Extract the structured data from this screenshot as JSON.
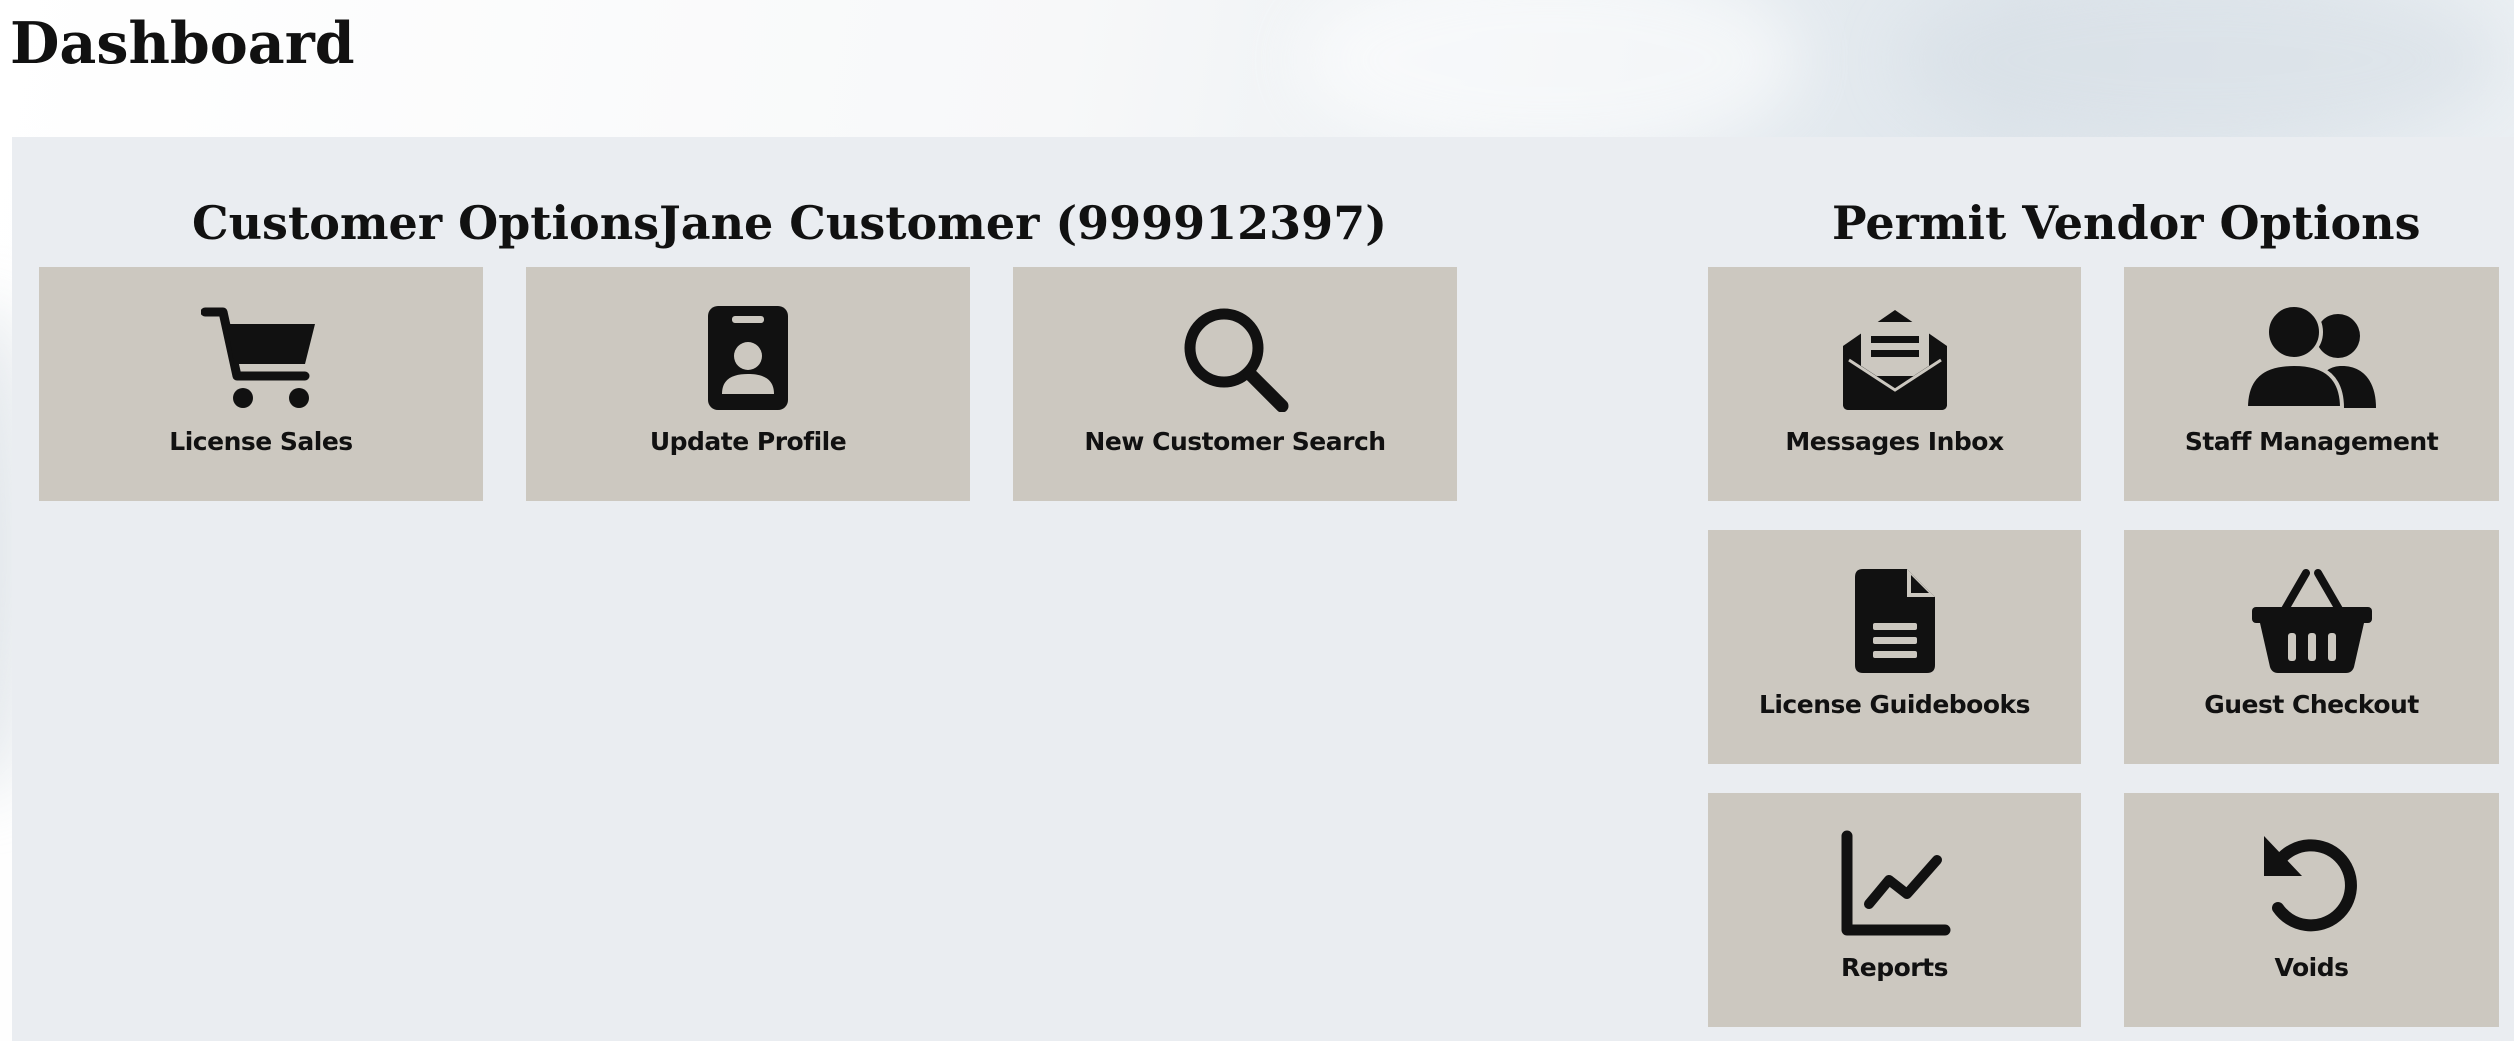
{
  "page": {
    "title": "Dashboard"
  },
  "customer_options": {
    "heading": "Customer Options",
    "customer_name": "Jane Customer (999912397)",
    "tiles": [
      {
        "label": "License Sales",
        "icon": "shopping-cart-icon"
      },
      {
        "label": "Update Profile",
        "icon": "id-badge-icon"
      },
      {
        "label": "New Customer Search",
        "icon": "magnifying-glass-icon"
      }
    ]
  },
  "vendor_options": {
    "heading": "Permit Vendor Options",
    "tiles": [
      {
        "label": "Messages Inbox",
        "icon": "envelope-open-icon"
      },
      {
        "label": "Staff Management",
        "icon": "users-icon"
      },
      {
        "label": "License Guidebooks",
        "icon": "document-icon"
      },
      {
        "label": "Guest Checkout",
        "icon": "basket-icon"
      },
      {
        "label": "Reports",
        "icon": "line-chart-icon"
      },
      {
        "label": "Voids",
        "icon": "undo-icon"
      }
    ]
  },
  "colors": {
    "tile_background": "#ccc8c0",
    "panel_background": "#eaedf1",
    "text": "#111111"
  }
}
